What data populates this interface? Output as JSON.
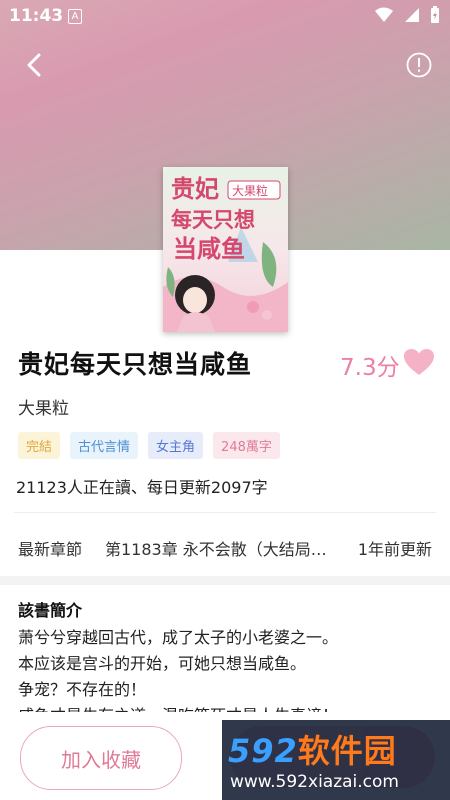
{
  "status_bar": {
    "time": "11:43",
    "notification_letter": "A"
  },
  "header": {
    "back_icon": "chevron-left-icon",
    "info_icon": "info-circle-icon"
  },
  "cover": {
    "title_line1": "贵妃",
    "title_line2": "每天只想",
    "title_line3": "当咸鱼",
    "author_badge": "大果粒"
  },
  "book": {
    "title": "贵妃每天只想当咸鱼",
    "score": "7.3分",
    "author": "大果粒",
    "tags": [
      "完結",
      "古代言情",
      "女主角",
      "248萬字"
    ],
    "readers_text": "21123人正在讀、每日更新2097字"
  },
  "latest": {
    "label": "最新章節",
    "chapter": "第1183章 永不会散（大结局…",
    "time": "1年前更新"
  },
  "intro": {
    "title": "該書簡介",
    "lines": [
      "萧兮兮穿越回古代，成了太子的小老婆之一。",
      "本应该是宫斗的开始，可她只想当咸鱼。",
      "争宠？不存在的！",
      "咸鱼才是生存之道，混吃等死才是人生真谛！"
    ]
  },
  "bottom": {
    "favorite_label": "加入收藏"
  },
  "watermark": {
    "num": "592",
    "cn": "软件园",
    "url": "www.592xiazai.com"
  },
  "colors": {
    "accent": "#ee7fa3",
    "hero_gradient_start": "#d9a9b4",
    "hero_gradient_end": "#a8b6a4"
  }
}
